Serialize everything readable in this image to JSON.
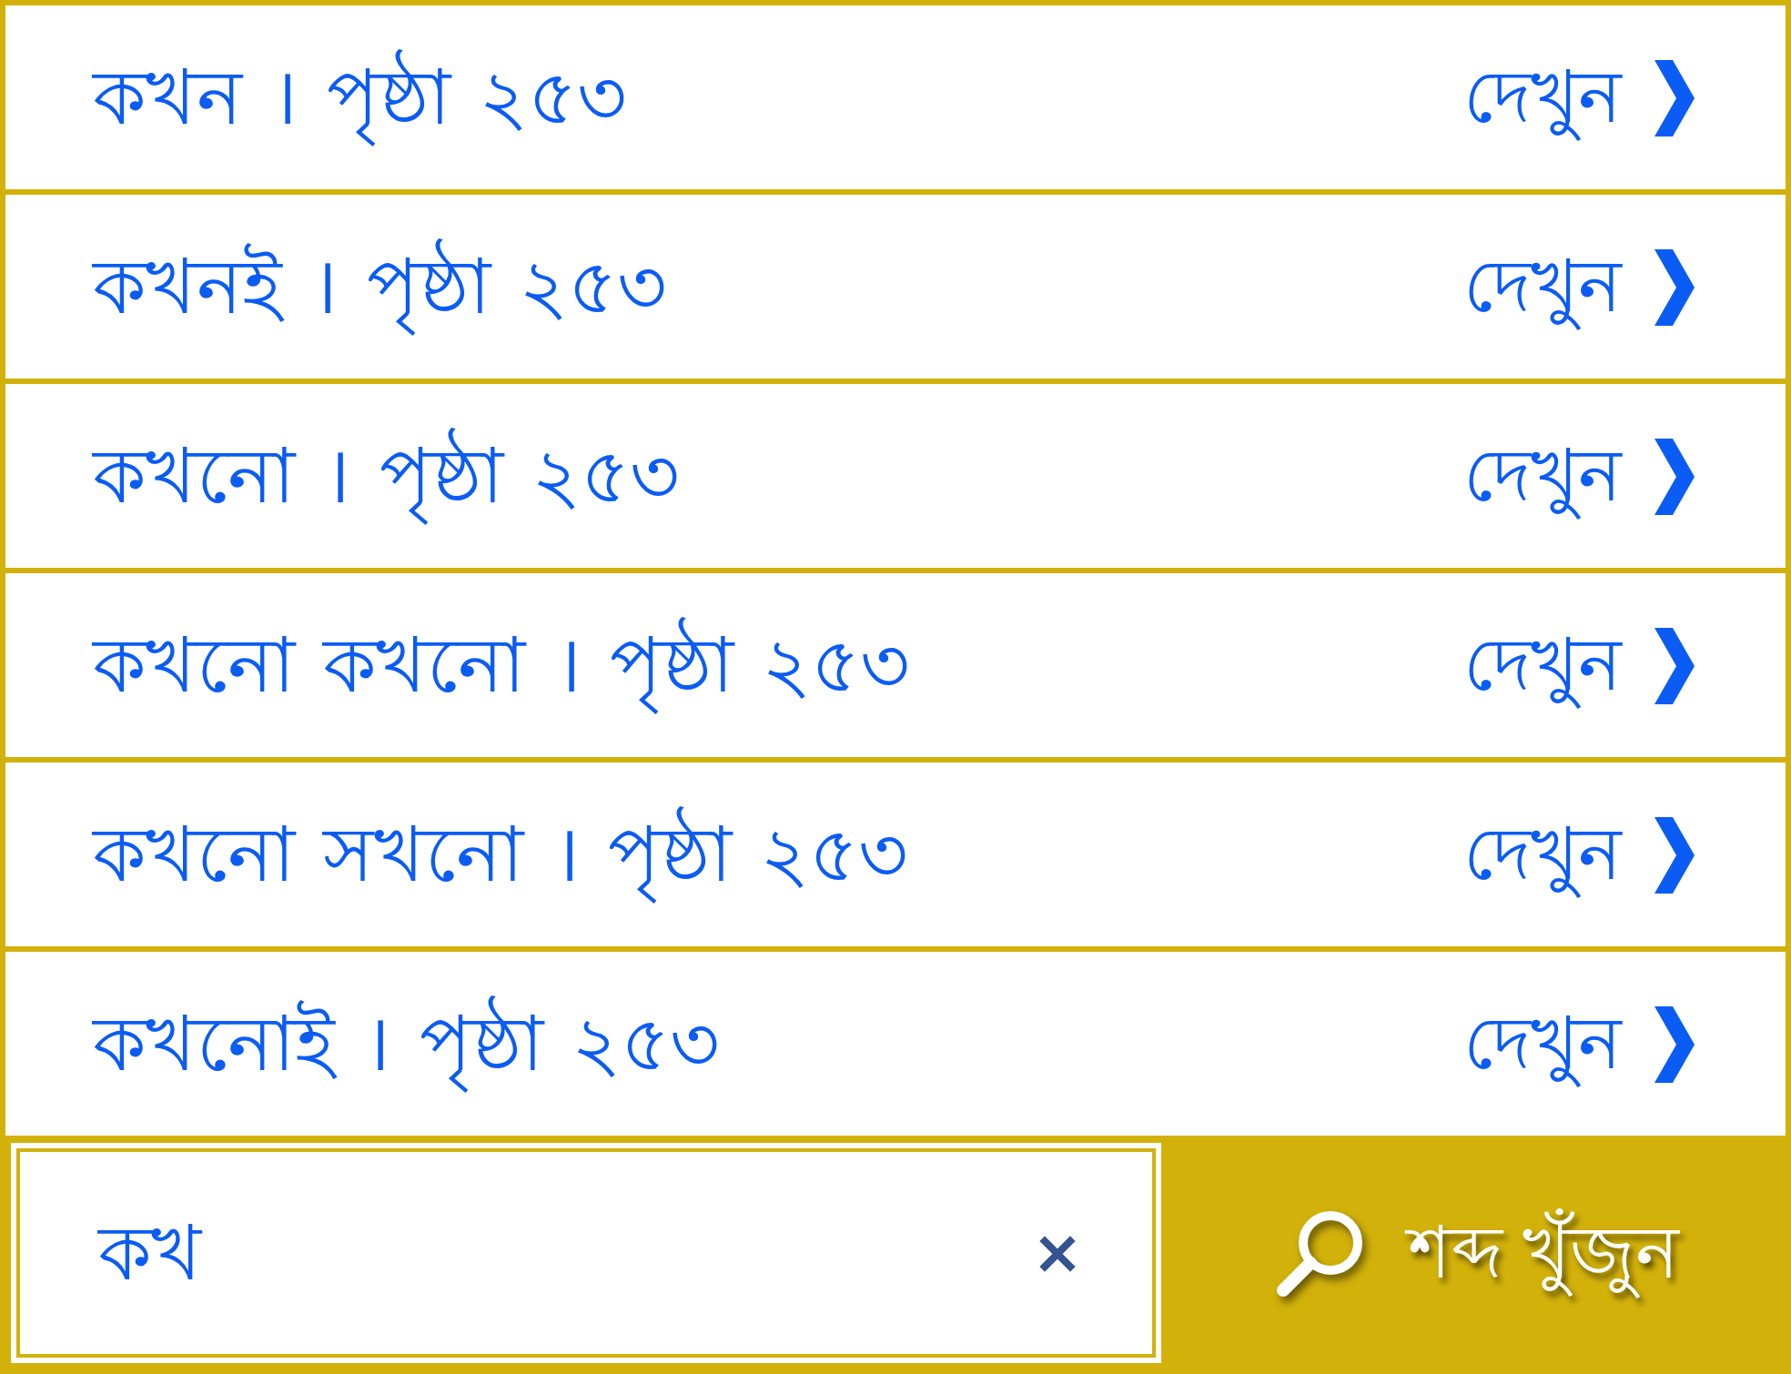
{
  "results": [
    {
      "text": "কখন । পৃষ্ঠা ২৫৩",
      "action": "দেখুন"
    },
    {
      "text": "কখনই । পৃষ্ঠা ২৫৩",
      "action": "দেখুন"
    },
    {
      "text": "কখনো । পৃষ্ঠা ২৫৩",
      "action": "দেখুন"
    },
    {
      "text": "কখনো কখনো । পৃষ্ঠা ২৫৩",
      "action": "দেখুন"
    },
    {
      "text": "কখনো সখনো । পৃষ্ঠা ২৫৩",
      "action": "দেখুন"
    },
    {
      "text": "কখনোই । পৃষ্ঠা ২৫৩",
      "action": "দেখুন"
    }
  ],
  "search": {
    "value": "কখ"
  },
  "search_button": {
    "label": "শব্দ খুঁজুন"
  }
}
